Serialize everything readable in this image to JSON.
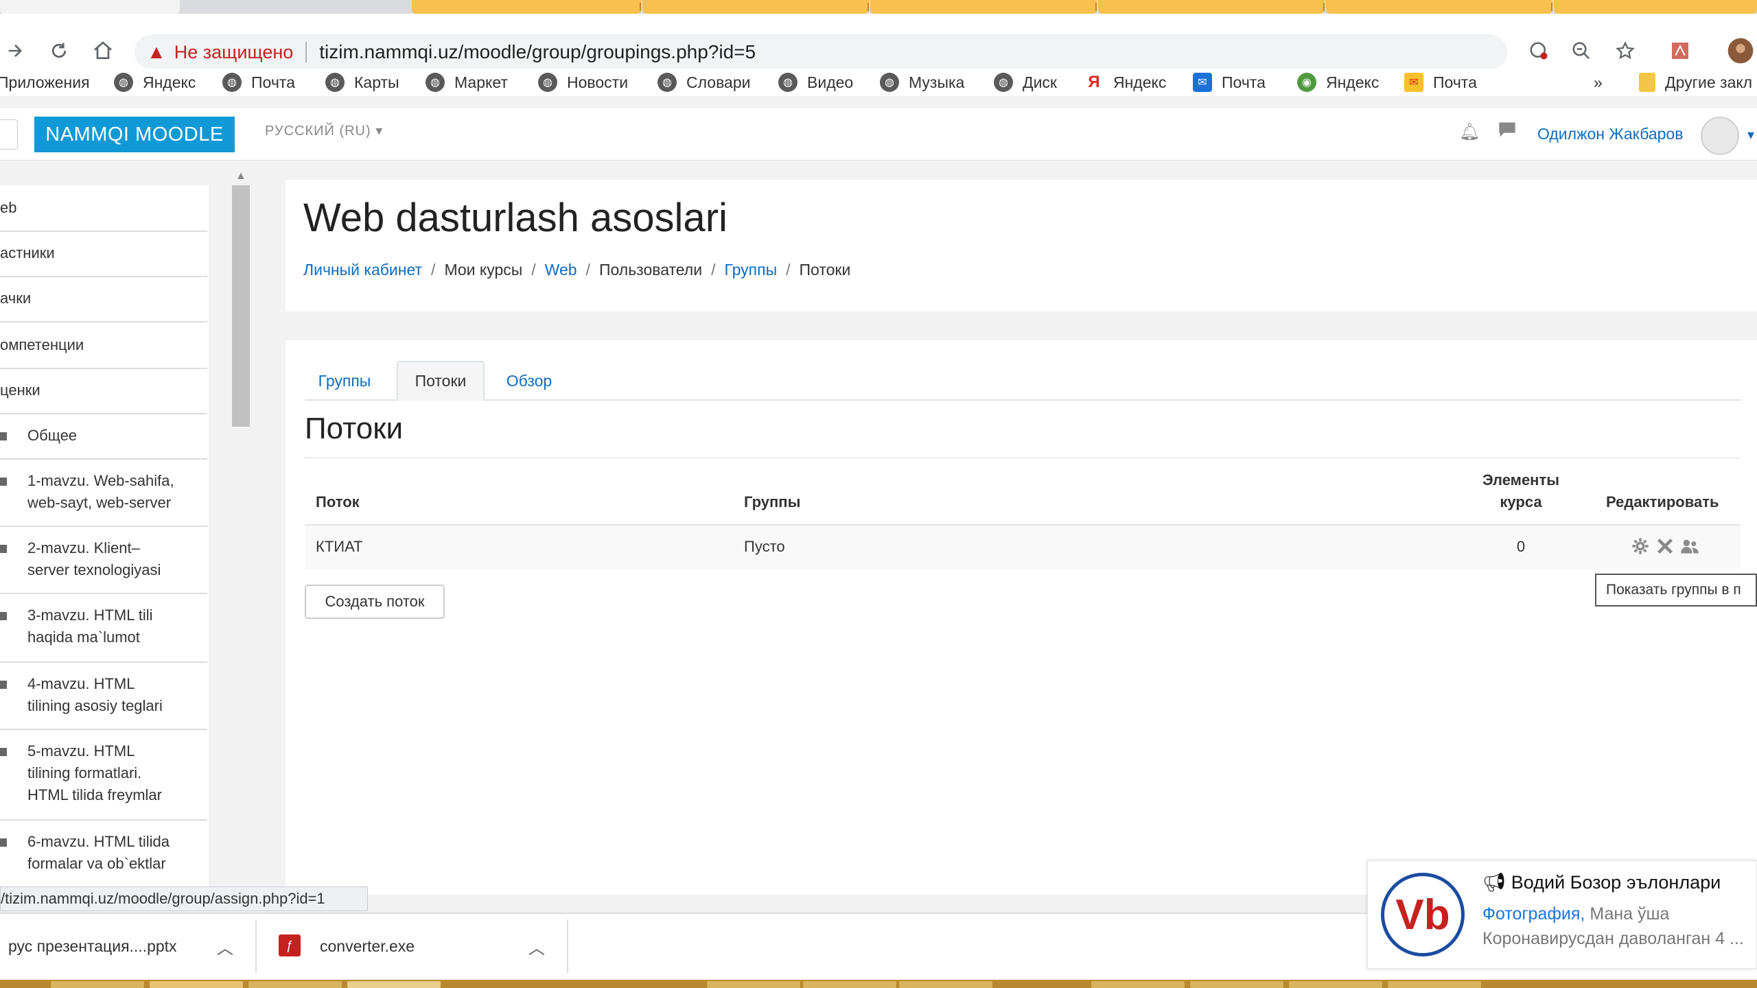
{
  "browser": {
    "address": {
      "insecure_label": "Не защищено",
      "url": "tizim.nammqi.uz/moodle/group/groupings.php?id=5"
    },
    "bookmarks": [
      {
        "label": "Приложения",
        "icon": "apps-icon"
      },
      {
        "label": "Яндекс",
        "icon": "globe-icon"
      },
      {
        "label": "Почта",
        "icon": "globe-icon"
      },
      {
        "label": "Карты",
        "icon": "globe-icon"
      },
      {
        "label": "Маркет",
        "icon": "globe-icon"
      },
      {
        "label": "Новости",
        "icon": "globe-icon"
      },
      {
        "label": "Словари",
        "icon": "globe-icon"
      },
      {
        "label": "Видео",
        "icon": "globe-icon"
      },
      {
        "label": "Музыка",
        "icon": "globe-icon"
      },
      {
        "label": "Диск",
        "icon": "globe-icon"
      },
      {
        "label": "Яндекс",
        "icon": "yandex-icon"
      },
      {
        "label": "Почта",
        "icon": "mail-icon"
      },
      {
        "label": "Яндекс",
        "icon": "yandex-browser-icon"
      },
      {
        "label": "Почта",
        "icon": "yandex-mail-icon"
      }
    ],
    "bookmarks_more": "»",
    "other_bookmarks": "Другие закл"
  },
  "moodle": {
    "brand": "NAMMQI MOODLE",
    "language": "РУССКИЙ (RU)",
    "user_name": "Одилжон Жакбаров"
  },
  "drawer": {
    "items": [
      {
        "label": "eb"
      },
      {
        "label": "астники"
      },
      {
        "label": "ачки"
      },
      {
        "label": "омпетенции"
      },
      {
        "label": "ценки"
      },
      {
        "label": "Общее"
      },
      {
        "lines": [
          "1-mavzu. Web-sahifa,",
          "web-sayt, web-server"
        ]
      },
      {
        "lines": [
          "2-mavzu. Klient–",
          "server texnologiyasi"
        ]
      },
      {
        "lines": [
          "3-mavzu. HTML tili",
          "haqida ma`lumot"
        ]
      },
      {
        "lines": [
          "4-mavzu. HTML",
          "tilining asosiy teglari"
        ]
      },
      {
        "lines": [
          "5-mavzu. HTML",
          "tilining formatlari.",
          "HTML tilida freymlar"
        ]
      },
      {
        "lines": [
          "6-mavzu. HTML tilida",
          "formalar va ob`ektlar"
        ]
      }
    ]
  },
  "header": {
    "course_title": "Web dasturlash asoslari",
    "breadcrumb": [
      {
        "label": "Личный кабинет",
        "link": true
      },
      {
        "label": "Мои курсы",
        "link": false
      },
      {
        "label": "Web",
        "link": true
      },
      {
        "label": "Пользователи",
        "link": false
      },
      {
        "label": "Группы",
        "link": true
      },
      {
        "label": "Потоки",
        "link": false
      }
    ]
  },
  "content": {
    "tabs": [
      {
        "label": "Группы",
        "active": false
      },
      {
        "label": "Потоки",
        "active": true
      },
      {
        "label": "Обзор",
        "active": false
      }
    ],
    "heading": "Потоки",
    "table": {
      "columns": {
        "grouping": "Поток",
        "groups": "Группы",
        "course_items_line1": "Элементы",
        "course_items_line2": "курса",
        "edit": "Редактировать"
      },
      "rows": [
        {
          "grouping": "КТИАТ",
          "groups": "Пусто",
          "course_items": "0"
        }
      ]
    },
    "create_button": "Создать поток",
    "tooltip": "Показать группы в п"
  },
  "status_url": "/tizim.nammqi.uz/moodle/group/assign.php?id=1",
  "downloads": [
    {
      "name": "рус презентация....pptx"
    },
    {
      "name": "converter.exe"
    }
  ],
  "notification": {
    "title": "Водий Бозор эълонлари",
    "link": "Фотография,",
    "line1_rest": " Мана ўша",
    "line2": "Коронавирусдан даволанган 4 ..."
  },
  "colors": {
    "accent": "#0f99d6",
    "link": "#0f6cbf",
    "insecure": "#c5221f",
    "tab_yellow": "#f7c04f"
  }
}
